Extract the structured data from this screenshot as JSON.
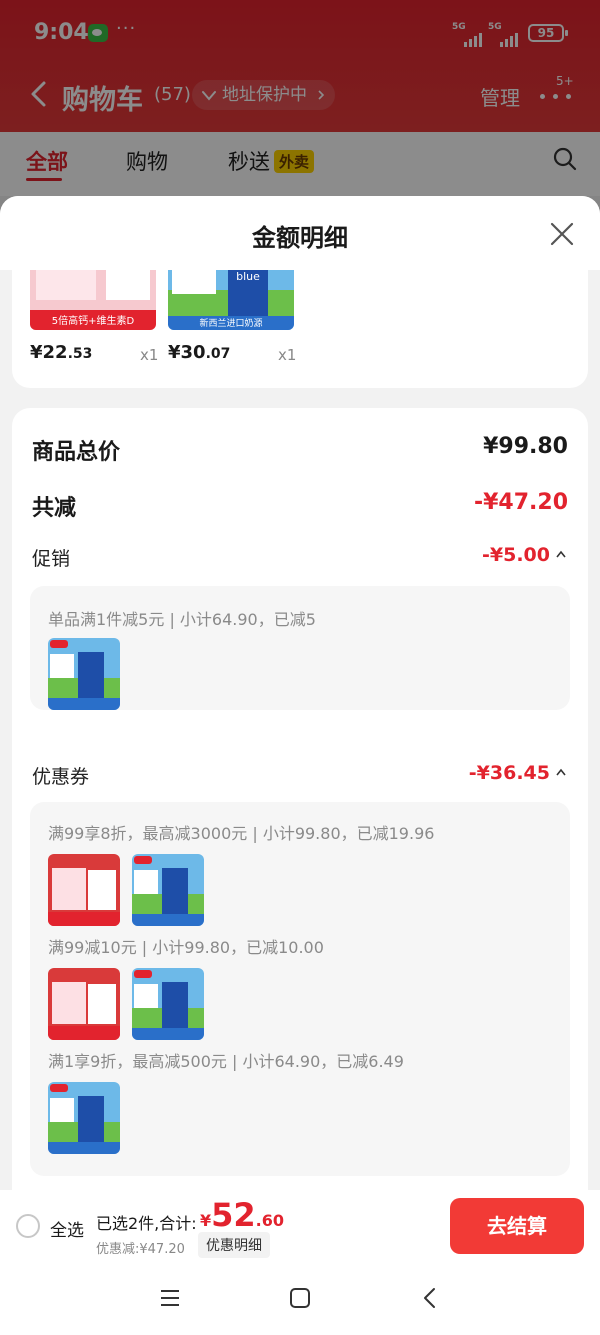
{
  "status_bar": {
    "time": "9:04",
    "more": "···",
    "signal1": "5G",
    "signal2": "5G",
    "battery": "95"
  },
  "nav": {
    "title": "购物车",
    "count": "(57)",
    "address_chip": "地址保护中",
    "manage": "管理",
    "more_badge": "5+"
  },
  "tabs": [
    {
      "label": "全部"
    },
    {
      "label": "购物"
    },
    {
      "label": "秒送",
      "tag": "外卖"
    }
  ],
  "sheet": {
    "title": "金额明细",
    "products": [
      {
        "price_int": "¥22",
        "price_dec": ".53",
        "qty": "x1",
        "banner": "5倍高钙+维生素D"
      },
      {
        "price_int": "¥30",
        "price_dec": ".07",
        "qty": "x1",
        "banner": "新西兰进口奶源"
      }
    ],
    "summary": {
      "total_label": "商品总价",
      "total_value": "¥99.80",
      "reduce_label": "共减",
      "reduce_value": "-¥47.20"
    },
    "promo": {
      "label": "促销",
      "value": "-¥5.00",
      "lines": [
        "单品满1件减5元 | 小计64.90，已减5"
      ]
    },
    "coupon": {
      "label": "优惠券",
      "value": "-¥36.45",
      "lines": [
        "满99享8折，最高减3000元 | 小计99.80，已减19.96",
        "满99减10元 | 小计99.80，已减10.00",
        "满1享9折，最高减500元 | 小计64.90，已减6.49"
      ]
    }
  },
  "bottom_bar": {
    "select_all": "全选",
    "selected_info": "已选2件,合计:",
    "total_currency": "¥",
    "total_int": "52",
    "total_dec": ".60",
    "discount": "优惠减:¥47.20",
    "detail_button": "优惠明细",
    "checkout": "去结算"
  },
  "colors": {
    "brand_red": "#e2232e",
    "checkout_red": "#f23a36",
    "tag_yellow": "#ffd400"
  }
}
